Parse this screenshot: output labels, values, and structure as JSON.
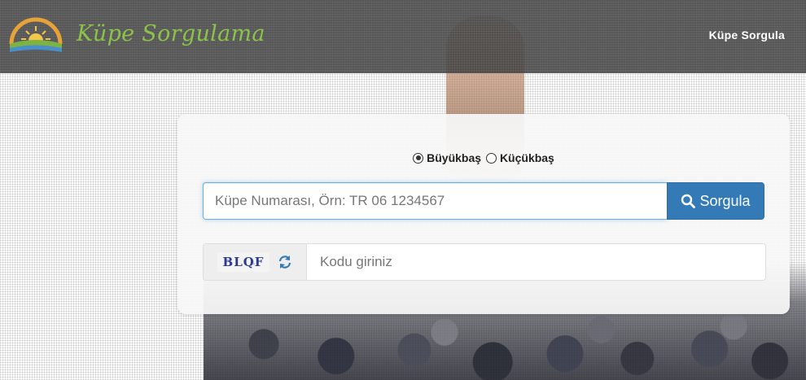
{
  "header": {
    "brand": "Küpe Sorgulama",
    "nav_link": "Küpe Sorgula",
    "brand_color": "#8bc34a"
  },
  "form": {
    "animal_type": {
      "options": [
        "Büyükbaş",
        "Küçükbaş"
      ],
      "selected": "Büyükbaş"
    },
    "search": {
      "placeholder": "Küpe Numarası, Örn: TR 06 1234567",
      "value": "",
      "button_label": "Sorgula",
      "button_icon": "search-icon",
      "button_color": "#337ab7"
    },
    "captcha": {
      "code_text": "BLQF",
      "refresh_icon": "refresh-icon",
      "placeholder": "Kodu giriniz",
      "value": ""
    }
  }
}
